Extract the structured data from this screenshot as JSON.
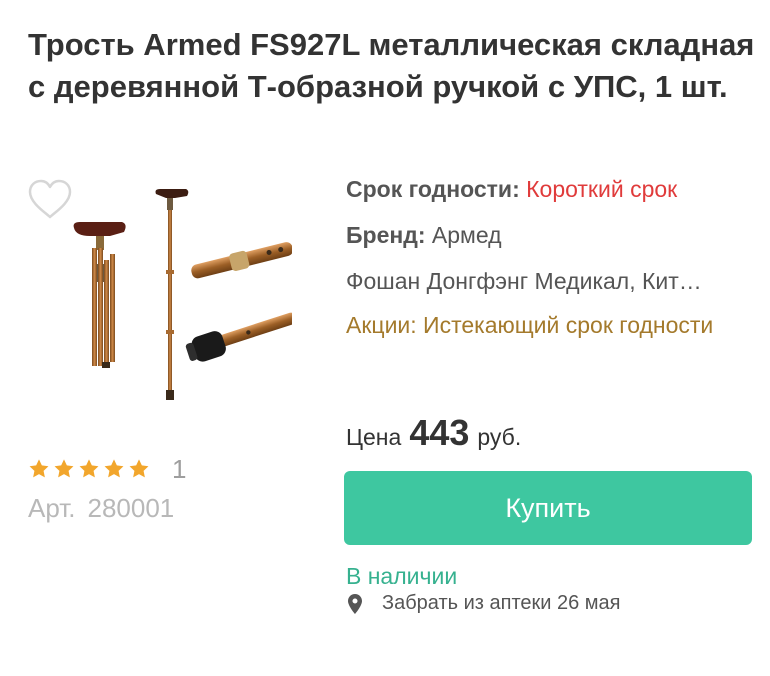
{
  "product": {
    "title": "Трость Armed FS927L металлическая складная с деревянной Т-образной ручкой с УПС, 1 шт.",
    "rating": {
      "stars": 5,
      "count": "1"
    },
    "sku_label": "Арт.",
    "sku_value": "280001"
  },
  "info": {
    "expiry_label": "Срок годности:",
    "expiry_value": "Короткий срок",
    "brand_label": "Бренд:",
    "brand_value": "Армед",
    "manufacturer": "Фошан Донгфэнг Медикал, Кит…",
    "promo": "Акции: Истекающий срок годности"
  },
  "price": {
    "label": "Цена",
    "value": "443",
    "currency": "руб."
  },
  "buy_label": "Купить",
  "availability": {
    "status": "В наличии",
    "pickup": "Забрать из аптеки 26 мая"
  },
  "icons": {
    "favorite": "heart-outline-icon",
    "star": "star-icon",
    "pin": "location-pin-icon"
  },
  "colors": {
    "accent": "#3ec7a0",
    "stock": "#36b18f",
    "expiry": "#e03b3b",
    "promo": "#a47a2c",
    "star": "#f2a62c"
  }
}
